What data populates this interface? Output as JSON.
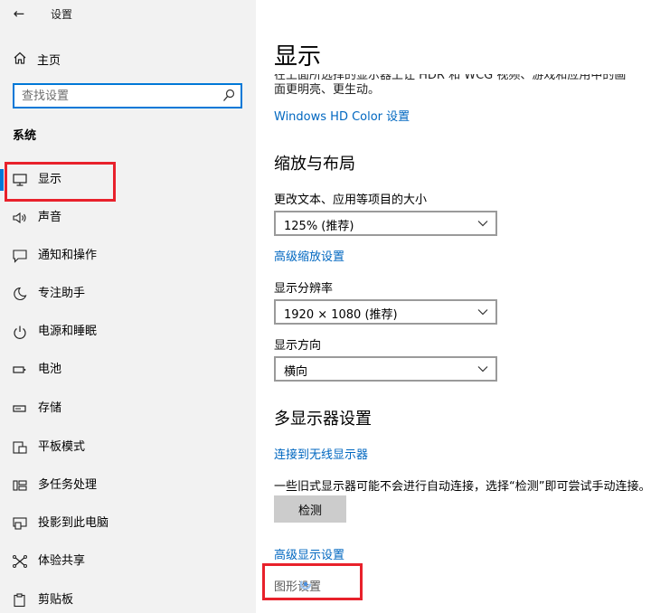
{
  "window": {
    "title": "设置",
    "back_glyph": "←"
  },
  "sidebar": {
    "home_label": "主页",
    "search_placeholder": "查找设置",
    "section_heading": "系统",
    "items": [
      {
        "label": "显示",
        "icon": "monitor-icon",
        "selected": true
      },
      {
        "label": "声音",
        "icon": "speaker-icon"
      },
      {
        "label": "通知和操作",
        "icon": "notification-icon"
      },
      {
        "label": "专注助手",
        "icon": "moon-icon"
      },
      {
        "label": "电源和睡眠",
        "icon": "power-icon"
      },
      {
        "label": "电池",
        "icon": "battery-icon"
      },
      {
        "label": "存储",
        "icon": "storage-icon"
      },
      {
        "label": "平板模式",
        "icon": "tablet-icon"
      },
      {
        "label": "多任务处理",
        "icon": "multitask-icon"
      },
      {
        "label": "投影到此电脑",
        "icon": "project-icon"
      },
      {
        "label": "体验共享",
        "icon": "share-icon"
      },
      {
        "label": "剪贴板",
        "icon": "clipboard-icon"
      }
    ]
  },
  "main": {
    "title": "显示",
    "hdr_description": "在上面所选择的显示器上让 HDR 和 WCG 视频、游戏和应用中的画面更明亮、更生动。",
    "hdr_link": "Windows HD Color 设置",
    "scale_heading": "缩放与布局",
    "scale_label": "更改文本、应用等项目的大小",
    "scale_value": "125% (推荐)",
    "advanced_scaling_link": "高级缩放设置",
    "resolution_label": "显示分辨率",
    "resolution_value": "1920 × 1080 (推荐)",
    "orientation_label": "显示方向",
    "orientation_value": "横向",
    "multi_heading": "多显示器设置",
    "wireless_link": "连接到无线显示器",
    "detect_description": "一些旧式显示器可能不会进行自动连接，选择“检测”即可尝试手动连接。",
    "detect_button": "检测",
    "advanced_display_link": "高级显示设置",
    "graphics_link": "图形设置"
  },
  "colors": {
    "accent": "#0078d7",
    "link": "#0067c0",
    "annotation": "#e8212b",
    "sidebar_bg": "#f2f2f2"
  }
}
